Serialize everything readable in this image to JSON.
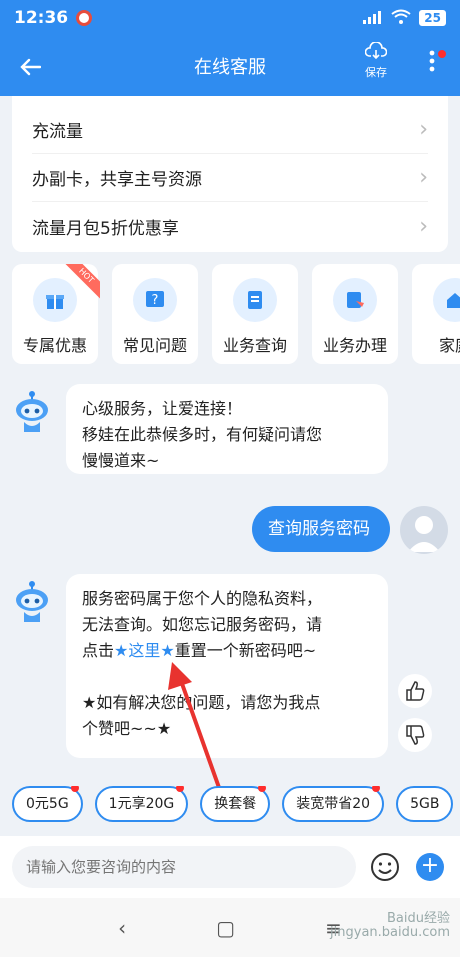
{
  "status": {
    "time": "12:36",
    "battery": "25"
  },
  "header": {
    "title": "在线客服",
    "save_label": "保存"
  },
  "quick_items": [
    {
      "label": "充流量"
    },
    {
      "label": "办副卡，共享主号资源"
    },
    {
      "label": "流量月包5折优惠享"
    }
  ],
  "services": [
    {
      "label": "专属优惠",
      "icon": "gift-icon",
      "badge": "HOT"
    },
    {
      "label": "常见问题",
      "icon": "question-icon"
    },
    {
      "label": "业务查询",
      "icon": "document-icon"
    },
    {
      "label": "业务办理",
      "icon": "handle-icon"
    },
    {
      "label": "家庭",
      "icon": "home-icon"
    }
  ],
  "chat": {
    "bot_msg1": [
      "心级服务，让爱连接！",
      "移娃在此恭候多时，有何疑问请您",
      "慢慢道来~"
    ],
    "user_msg": "查询服务密码",
    "bot_msg2": {
      "line1": "服务密码属于您个人的隐私资料，",
      "line2": "无法查询。如您忘记服务密码，请",
      "line3_pre": "点击",
      "star": "★",
      "link": "这里",
      "line3_post": "重置一个新密码吧~",
      "line4": "★如有解决您的问题，请您为我点",
      "line5": "个赞吧~~★"
    }
  },
  "chips": [
    {
      "label": "0元5G"
    },
    {
      "label": "1元享20G"
    },
    {
      "label": "换套餐"
    },
    {
      "label": "装宽带省20"
    },
    {
      "label": "5GB"
    }
  ],
  "input": {
    "placeholder": "请输入您要咨询的内容"
  },
  "watermark": {
    "line1": "Baidu经验",
    "line2": "jingyan.baidu.com"
  },
  "colors": {
    "primary": "#2f8cf0",
    "badge": "#ff2d2d",
    "background": "#eef2f7"
  }
}
